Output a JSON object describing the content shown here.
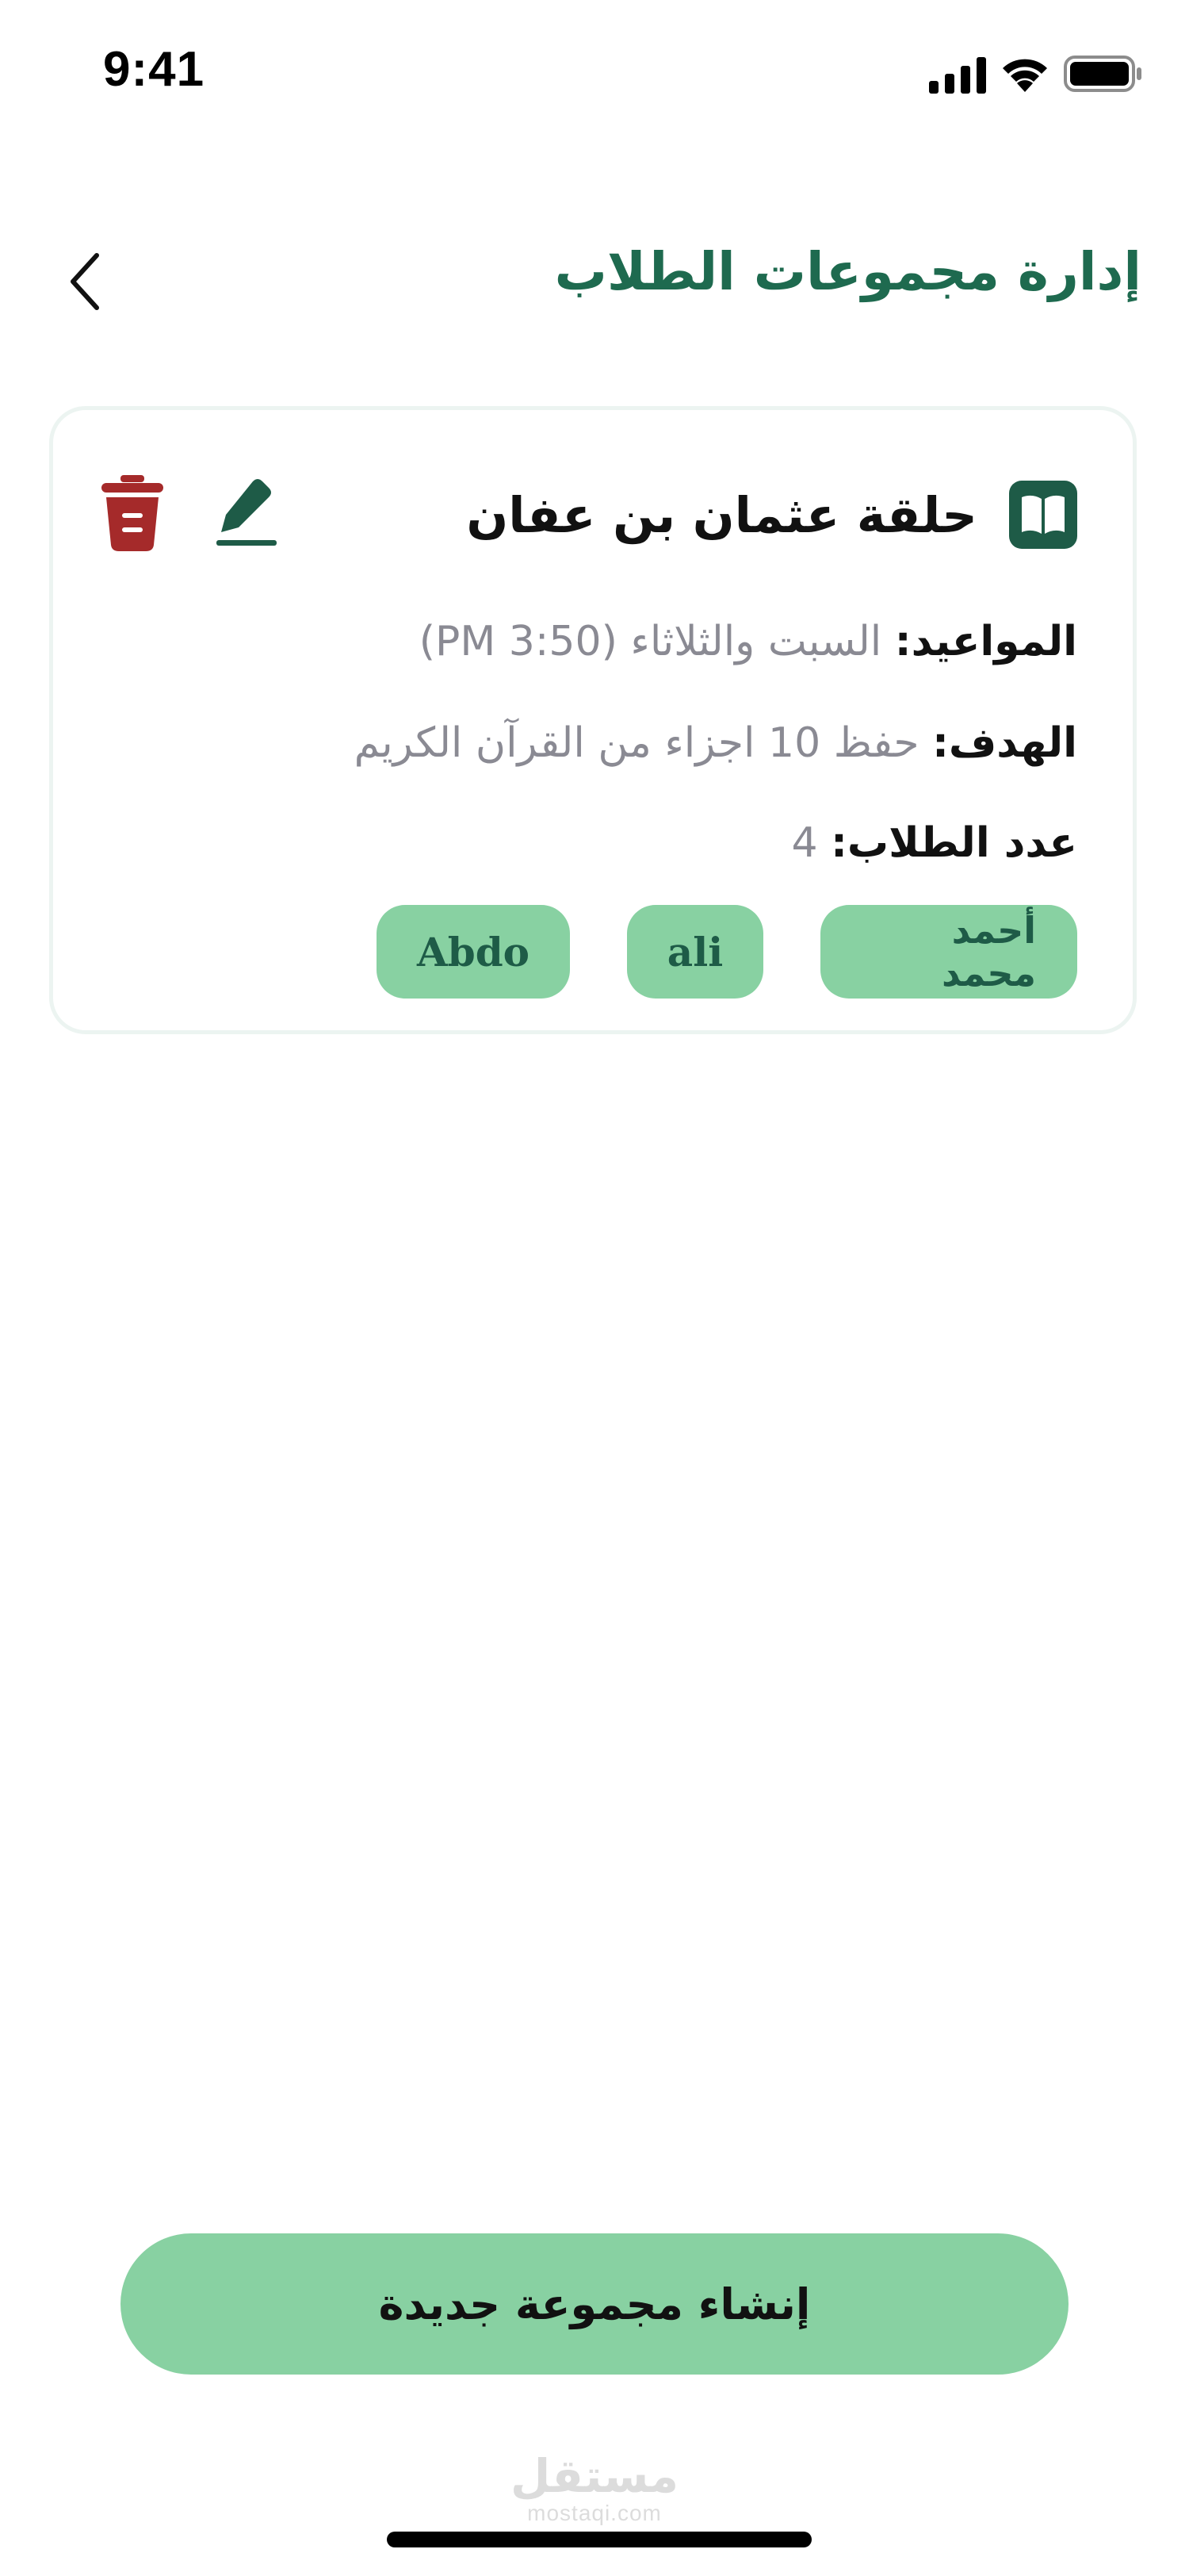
{
  "status_bar": {
    "time": "9:41"
  },
  "header": {
    "title": "إدارة مجموعات الطلاب",
    "back_icon": "chevron-left-icon"
  },
  "group": {
    "name": "حلقة عثمان بن عفان",
    "icon": "book-icon",
    "edit_icon": "edit-pencil-icon",
    "delete_icon": "trash-icon",
    "schedule_label": "المواعيد:",
    "schedule_value": "السبت والثلاثاء (PM 3:50)",
    "goal_label": "الهدف:",
    "goal_value": "حفظ 10 اجزاء من القرآن الكريم",
    "count_label": "عدد الطلاب:",
    "count_value": "4",
    "students": [
      "أحمد محمد",
      "ali",
      "Abdo"
    ]
  },
  "create_button_label": "إنشاء مجموعة جديدة",
  "watermark": {
    "arabic": "مستقل",
    "latin": "mostaqi.com"
  },
  "colors": {
    "brand_green": "#1e6a4f",
    "chip_green": "#88d1a2",
    "delete_red": "#a52a2a",
    "muted_text": "#8a8a93"
  }
}
